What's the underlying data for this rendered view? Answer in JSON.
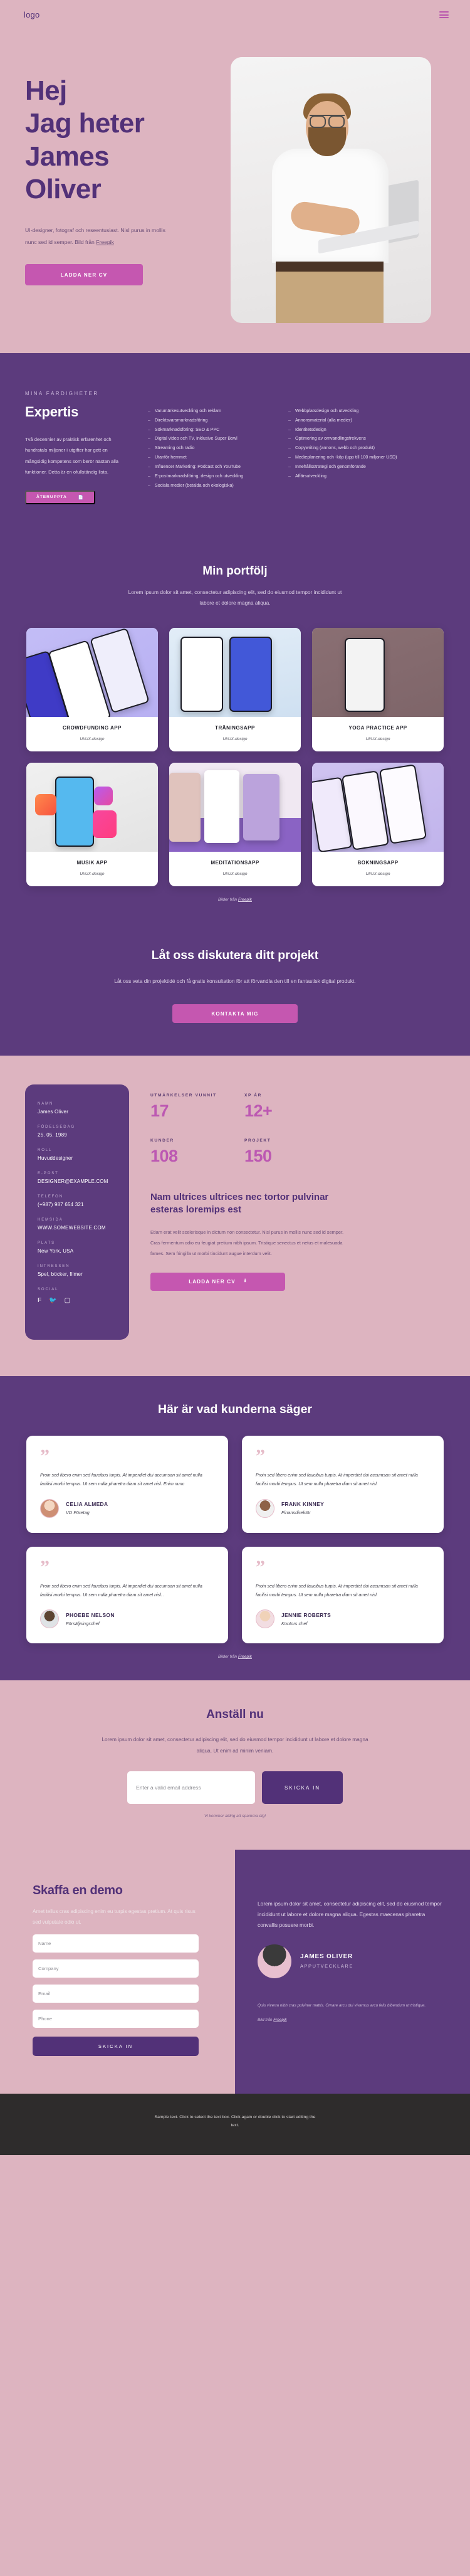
{
  "header": {
    "logo": "logo",
    "menu_icon": "hamburger-icon"
  },
  "hero": {
    "title_line1": "Hej",
    "title_line2": "Jag heter",
    "title_line3": "James",
    "title_line4": "Oliver",
    "subtitle": "UI-designer, fotograf och reseentusiast. Nisl purus in mollis nunc sed id semper. Bild från ",
    "subtitle_link": "Freepik",
    "cta": "LADDA NER CV"
  },
  "expertis": {
    "eyebrow": "MINA FÄRDIGHETER",
    "title": "Expertis",
    "paragraph": "Två decennier av praktisk erfarenhet och hundratals miljoner i utgifter har gett en mångsidig kompetens som berör nästan alla funktioner. Detta är en ofullständig lista.",
    "button": "ÅTERUPPTA",
    "button_icon": "document-icon",
    "list_col1": [
      "Varumärkesutveckling och reklam",
      "Direktsvarsmarknadsföring",
      "Sökmarknadsföring: SEO & PPC",
      "Digital video och TV, inklusive Super Bowl",
      "Streaming och radio",
      "Utanför hemmet",
      "Influencer Marketing: Podcast och YouTube",
      "E-postmarknadsföring, design och utveckling",
      "Sociala medier (betalda och ekologiska)"
    ],
    "list_col2": [
      "Webbplatsdesign och utveckling",
      "Annonsmaterial (alla medier)",
      "Identitetsdesign",
      "Optimering av omvandlingsfrekvens",
      "Copywriting (annons, webb och produkt)",
      "Medieplanering och -köp (upp till 100 miljoner USD)",
      "Innehållsstrategi och genomförande",
      "Affärsutveckling"
    ]
  },
  "portfolio": {
    "title": "Min portfölj",
    "subtitle": "Lorem ipsum dolor sit amet, consectetur adipiscing elit, sed do eiusmod tempor incididunt ut labore et dolore magna aliqua.",
    "items": [
      {
        "title": "CROWDFUNDING APP",
        "meta": "UI/UX-design"
      },
      {
        "title": "TRÄNINGSAPP",
        "meta": "UI/UX-design"
      },
      {
        "title": "YOGA PRACTICE APP",
        "meta": "UI/UX-design"
      },
      {
        "title": "MUSIK APP",
        "meta": "UI/UX-design"
      },
      {
        "title": "MEDITATIONSAPP",
        "meta": "UI/UX-design"
      },
      {
        "title": "BOKNINGSAPP",
        "meta": "UI/UX-design"
      }
    ],
    "credit_prefix": "Bilder från ",
    "credit_link": "Freepik"
  },
  "cta_section": {
    "title": "Låt oss diskutera ditt projekt",
    "paragraph": "Låt oss veta din projektidé och få gratis konsultation för att förvandla den till en fantastisk digital produkt.",
    "button": "KONTAKTA MIG"
  },
  "details": {
    "vcard": [
      {
        "label": "NAMN",
        "value": "James Oliver"
      },
      {
        "label": "FÖDELSEDAG",
        "value": "25. 05. 1989"
      },
      {
        "label": "ROLL",
        "value": "Huvuddesigner"
      },
      {
        "label": "E-POST",
        "value": "DESIGNER@EXAMPLE.COM"
      },
      {
        "label": "TELEFON",
        "value": "(+987) 987 654 321"
      },
      {
        "label": "HEMSIDA",
        "value": "WWW.SOMEWEBSITE.COM"
      },
      {
        "label": "PLATS",
        "value": "New York, USA"
      },
      {
        "label": "INTRESSEN",
        "value": "Spel, böcker, filmer"
      }
    ],
    "social_label": "SOCIAL",
    "socials": [
      "facebook-icon",
      "twitter-icon",
      "instagram-icon"
    ],
    "stats": [
      {
        "label": "UTMÄRKELSER VUNNIT",
        "value": "17"
      },
      {
        "label": "XP ÅR",
        "value": "12+"
      },
      {
        "label": "KUNDER",
        "value": "108"
      },
      {
        "label": "PROJEKT",
        "value": "150"
      }
    ],
    "title": "Nam ultrices ultrices nec tortor pulvinar esteras loremips est",
    "paragraph": "Etiam erat velit scelerisque in dictum non consectetur. Nisl purus in mollis nunc sed id semper. Cras fermentum odio eu feugiat pretium nibh ipsum. Tristique senectus et netus et malesuada fames. Sem fringilla ut morbi tincidunt augue interdum velit.",
    "button": "LADDA NER CV",
    "button_icon": "download-icon"
  },
  "testimonials": {
    "title": "Här är vad kunderna säger",
    "items": [
      {
        "quote": "Proin sed libero enim sed faucibus turpis. At imperdiet dui accumsan sit amet nulla facilisi morbi tempus. Ut sem nulla pharetra diam sit amet nisl. Enim nunc",
        "name": "CELIA ALMEDA",
        "role": "VD Företag"
      },
      {
        "quote": "Proin sed libero enim sed faucibus turpis. At imperdiet dui accumsan sit amet nulla facilisi morbi tempus. Ut sem nulla pharetra diam sit amet nisl.",
        "name": "FRANK KINNEY",
        "role": "Finansdirektör"
      },
      {
        "quote": "Proin sed libero enim sed faucibus turpis. At imperdiet dui accumsan sit amet nulla facilisi morbi tempus. Ut sem nulla pharetra diam sit amet nisl. .",
        "name": "PHOEBE NELSON",
        "role": "Försäljningschef"
      },
      {
        "quote": "Proin sed libero enim sed faucibus turpis. At imperdiet dui accumsan sit amet nulla facilisi morbi tempus. Ut sem nulla pharetra diam sit amet nisl.",
        "name": "JENNIE ROBERTS",
        "role": "Kontors chef"
      }
    ],
    "credit_prefix": "Bilder från ",
    "credit_link": "Freepik"
  },
  "hire": {
    "title": "Anställ nu",
    "paragraph": "Lorem ipsum dolor sit amet, consectetur adipiscing elit, sed do eiusmod tempor incididunt ut labore et dolore magna aliqua. Ut enim ad minim veniam.",
    "email_placeholder": "Enter a valid email address",
    "submit": "SKICKA IN",
    "note": "Vi kommer aldrig att spamma dig!"
  },
  "demo": {
    "title": "Skaffa en demo",
    "paragraph": "Amet tellus cras adipiscing enim eu turpis egestas pretium. At quis risus sed vulputate odio ut.",
    "fields": [
      {
        "placeholder": "Name"
      },
      {
        "placeholder": "Company"
      },
      {
        "placeholder": "Email"
      },
      {
        "placeholder": "Phone"
      }
    ],
    "submit": "SKICKA IN",
    "right_paragraph": "Lorem ipsum dolor sit amet, consectetur adipiscing elit, sed do eiusmod tempor incididunt ut labore et dolore magna aliqua. Egestas maecenas pharetra convallis posuere morbi.",
    "person_name": "JAMES OLIVER",
    "person_role": "APPUTVECKLARE",
    "fine_print": "Quis viverra nibh cras pulvinar mattis. Ornare arcu dui vivamus arcu felis bibendum ut tristique.",
    "credit_prefix": "Bild från ",
    "credit_link": "Freepik"
  },
  "footer": {
    "text": "Sample text. Click to select the text box. Click again or double click to start editing the text."
  },
  "colors": {
    "pink_bg": "#ddb4c0",
    "purple_bg": "#5c3b7d",
    "accent_pink": "#c557b0",
    "deep_purple": "#523178",
    "footer_bg": "#2e2c2c"
  }
}
